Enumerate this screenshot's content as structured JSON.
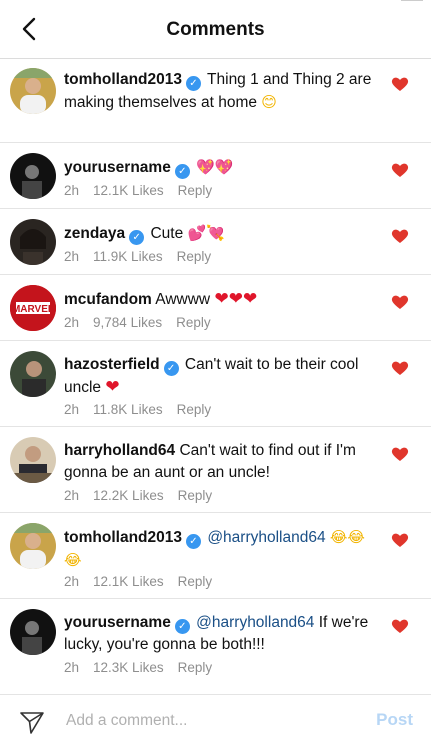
{
  "header": {
    "title": "Comments"
  },
  "comments": [
    {
      "username": "tomholland2013",
      "verified": true,
      "text_pre": "Thing 1 and Thing 2 are making themselves at home",
      "emoji": "😊"
    },
    {
      "username": "yourusername",
      "verified": true,
      "text_pre": "",
      "emoji": "💖💖",
      "time": "2h",
      "likes": "12.1K Likes",
      "reply": "Reply"
    },
    {
      "username": "zendaya",
      "verified": true,
      "text_pre": "Cute",
      "emoji": "💕💘",
      "time": "2h",
      "likes": "11.9K Likes",
      "reply": "Reply"
    },
    {
      "username": "mcufandom",
      "verified": false,
      "text_pre": "Awwww",
      "emoji": "❤❤❤",
      "time": "2h",
      "likes": "9,784 Likes",
      "reply": "Reply",
      "avatar_text": "MARVEL"
    },
    {
      "username": "hazosterfield",
      "verified": true,
      "text_pre": "Can't wait to be their cool uncle",
      "emoji": "❤",
      "time": "2h",
      "likes": "11.8K Likes",
      "reply": "Reply"
    },
    {
      "username": "harryholland64",
      "verified": false,
      "text_pre": "Can't wait to find out if I'm gonna be an aunt or an uncle!",
      "emoji": "",
      "time": "2h",
      "likes": "12.2K Likes",
      "reply": "Reply"
    },
    {
      "username": "tomholland2013",
      "verified": true,
      "mention": "@harryholland64",
      "text_pre": "",
      "emoji": "😂😂😂",
      "time": "2h",
      "likes": "12.1K Likes",
      "reply": "Reply"
    },
    {
      "username": "yourusername",
      "verified": true,
      "mention": "@harryholland64",
      "text_pre": "If we're lucky, you're gonna be both!!!",
      "emoji": "",
      "time": "2h",
      "likes": "12.3K Likes",
      "reply": "Reply"
    }
  ],
  "footer": {
    "placeholder": "Add a comment...",
    "post_label": "Post"
  },
  "colors": {
    "like_heart": "#e0362c",
    "verified": "#3897f0",
    "mention": "#1a4f86",
    "post": "#b7d6f5"
  },
  "icons": {
    "back": "chevron-left-icon",
    "like": "heart-icon",
    "send": "paper-plane-icon"
  }
}
